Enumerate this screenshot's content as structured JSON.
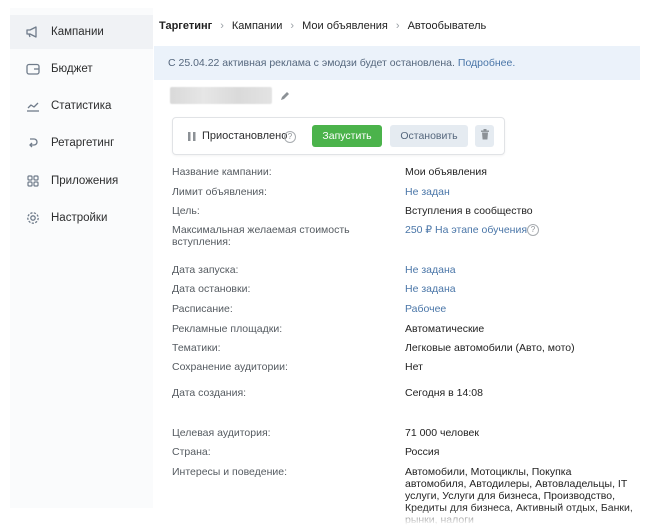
{
  "sidebar": {
    "items": [
      {
        "label": "Кампании",
        "icon": "megaphone-icon",
        "active": true
      },
      {
        "label": "Бюджет",
        "icon": "wallet-icon",
        "active": false
      },
      {
        "label": "Статистика",
        "icon": "chart-icon",
        "active": false
      },
      {
        "label": "Ретаргетинг",
        "icon": "retarget-icon",
        "active": false
      },
      {
        "label": "Приложения",
        "icon": "apps-grid-icon",
        "active": false
      },
      {
        "label": "Настройки",
        "icon": "gear-icon",
        "active": false
      }
    ]
  },
  "breadcrumbs": [
    "Таргетинг",
    "Кампании",
    "Мои объявления",
    "Автообыватель"
  ],
  "banner": {
    "text": "С 25.04.22 активная реклама с эмодзи будет остановлена.",
    "link": "Подробнее."
  },
  "status": {
    "label": "Приостановлено",
    "help": "?",
    "start_label": "Запустить",
    "stop_label": "Остановить"
  },
  "details": [
    {
      "label": "Название кампании:",
      "value": "Мои объявления",
      "link": false
    },
    {
      "label": "Лимит объявления:",
      "value": "Не задан",
      "link": true
    },
    {
      "label": "Цель:",
      "value": "Вступления в сообщество",
      "link": false
    },
    {
      "label": "Максимальная желаемая стоимость вступления:",
      "value": "250 ₽ На этапе обучения",
      "link": true,
      "help": "?"
    },
    {
      "label": "Дата запуска:",
      "value": "Не задана",
      "link": true
    },
    {
      "label": "Дата остановки:",
      "value": "Не задана",
      "link": true
    },
    {
      "label": "Расписание:",
      "value": "Рабочее",
      "link": true
    },
    {
      "label": "Рекламные площадки:",
      "value": "Автоматические",
      "link": false
    },
    {
      "label": "Тематики:",
      "value": "Легковые автомобили (Авто, мото)",
      "link": false
    },
    {
      "label": "Сохранение аудитории:",
      "value": "Нет",
      "link": false
    },
    {
      "label": "Дата создания:",
      "value": "Сегодня в 14:08",
      "link": false
    },
    {
      "label": "Целевая аудитория:",
      "value": "71 000 человек",
      "link": false
    },
    {
      "label": "Страна:",
      "value": "Россия",
      "link": false
    },
    {
      "label": "Интересы и поведение:",
      "value": "Автомобили, Мотоциклы, Покупка автомобиля, Автодилеры, Автовладельцы, IT услуги, Услуги для бизнеса, Производство, Кредиты для бизнеса, Активный отдых, Банки, рынки, налоги",
      "link": false
    }
  ],
  "colors": {
    "accent_link": "#4a76a8",
    "start_button": "#4bb34b",
    "banner_bg": "#ebf2fa"
  }
}
